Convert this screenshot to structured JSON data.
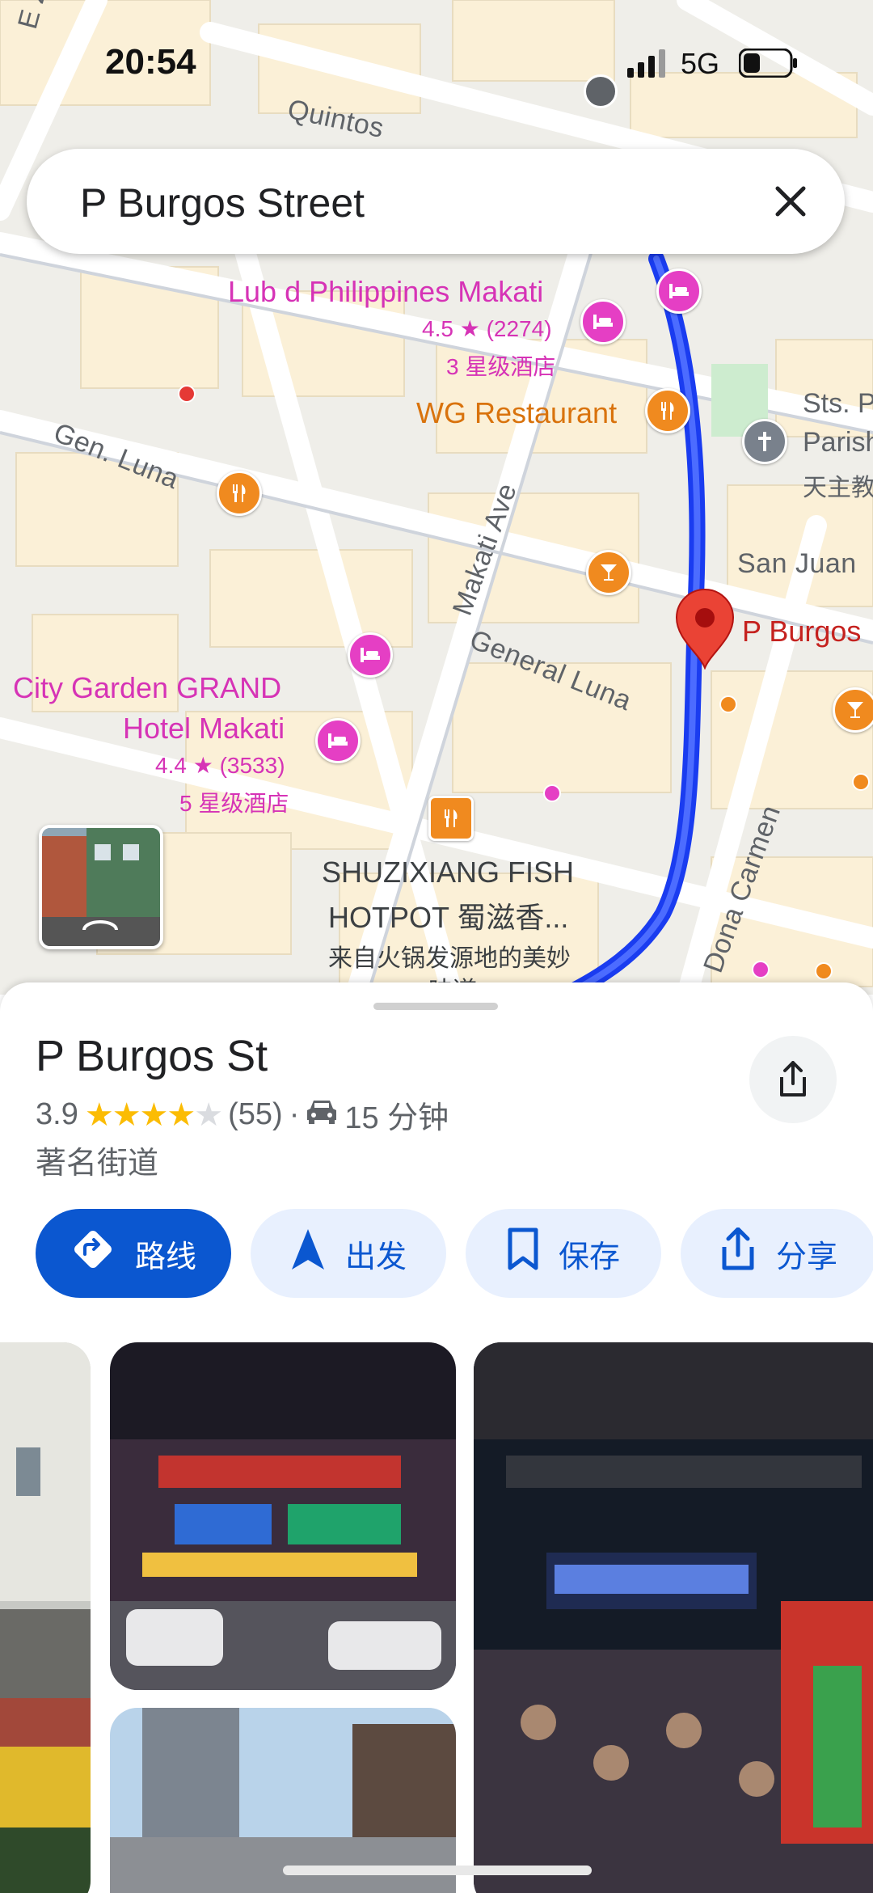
{
  "status_bar": {
    "time": "20:54",
    "network": "5G"
  },
  "search": {
    "query": "P Burgos Street"
  },
  "map": {
    "streets": [
      "E Zobel",
      "Quintos",
      "Gen. Luna",
      "Makati Ave",
      "General Luna",
      "San Juan",
      "Dona Carmen"
    ],
    "pois": {
      "lubd": {
        "name": "Lub d Philippines Makati",
        "rating": "4.5 ★ (2274)",
        "class": "3 星级酒店"
      },
      "wg": {
        "name": "WG Restaurant"
      },
      "church": {
        "name_line1": "Sts. P",
        "name_line2": "Parish",
        "name_line3": "天主教"
      },
      "city_garden": {
        "name_line1": "City Garden GRAND",
        "name_line2": "Hotel Makati",
        "rating": "4.4 ★ (3533)",
        "class": "5 星级酒店"
      },
      "shuzixiang": {
        "name_line1": "SHUZIXIANG FISH",
        "name_line2": "HOTPOT 蜀滋香...",
        "desc": "来自火锅发源地的美妙",
        "desc2": "味道"
      },
      "pburgos_pin": {
        "name": "P Burgos"
      }
    }
  },
  "place": {
    "title": "P Burgos St",
    "rating": "3.9",
    "stars_filled": 4,
    "reviews": "(55)",
    "separator": "·",
    "drive_time": "15 分钟",
    "category": "著名街道"
  },
  "actions": {
    "directions": "路线",
    "start": "出发",
    "save": "保存",
    "share": "分享"
  },
  "colors": {
    "accent": "#0b57d0",
    "route": "#1a3cf0",
    "pin": "#ea4335"
  }
}
